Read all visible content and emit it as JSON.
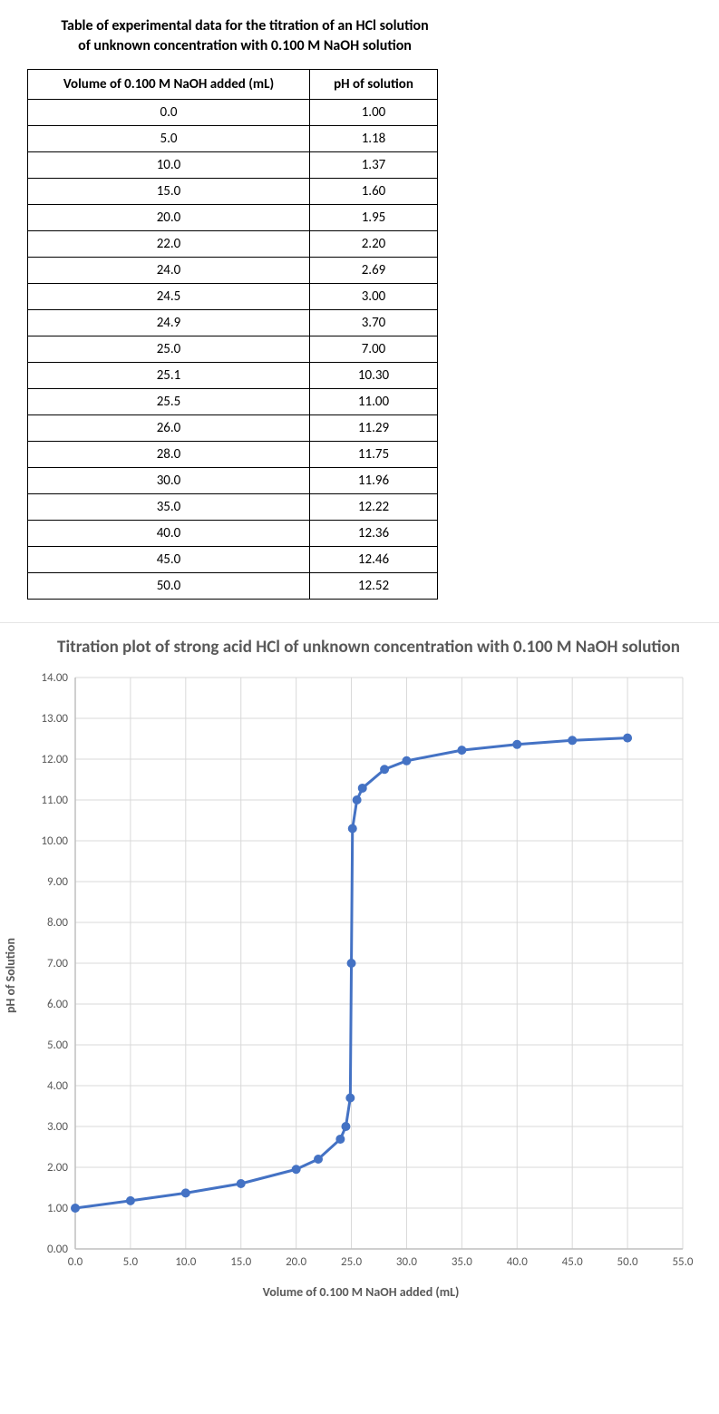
{
  "table": {
    "title": "Table of experimental data for the titration of an HCl solution of unknown concentration with 0.100 M NaOH solution",
    "headers": [
      "Volume of 0.100 M NaOH added (mL)",
      "pH of solution"
    ],
    "rows": [
      {
        "vol": "0.0",
        "ph": "1.00"
      },
      {
        "vol": "5.0",
        "ph": "1.18"
      },
      {
        "vol": "10.0",
        "ph": "1.37"
      },
      {
        "vol": "15.0",
        "ph": "1.60"
      },
      {
        "vol": "20.0",
        "ph": "1.95"
      },
      {
        "vol": "22.0",
        "ph": "2.20"
      },
      {
        "vol": "24.0",
        "ph": "2.69"
      },
      {
        "vol": "24.5",
        "ph": "3.00"
      },
      {
        "vol": "24.9",
        "ph": "3.70"
      },
      {
        "vol": "25.0",
        "ph": "7.00"
      },
      {
        "vol": "25.1",
        "ph": "10.30"
      },
      {
        "vol": "25.5",
        "ph": "11.00"
      },
      {
        "vol": "26.0",
        "ph": "11.29"
      },
      {
        "vol": "28.0",
        "ph": "11.75"
      },
      {
        "vol": "30.0",
        "ph": "11.96"
      },
      {
        "vol": "35.0",
        "ph": "12.22"
      },
      {
        "vol": "40.0",
        "ph": "12.36"
      },
      {
        "vol": "45.0",
        "ph": "12.46"
      },
      {
        "vol": "50.0",
        "ph": "12.52"
      }
    ]
  },
  "chart_data": {
    "type": "line",
    "title": "Titration plot of strong acid HCl of unknown concentration with 0.100 M NaOH solution",
    "xlabel": "Volume of 0.100 M NaOH added (mL)",
    "ylabel": "pH of Solution",
    "xlim": [
      0,
      55
    ],
    "ylim": [
      0,
      14
    ],
    "x_ticks": [
      "0.0",
      "5.0",
      "10.0",
      "15.0",
      "20.0",
      "25.0",
      "30.0",
      "35.0",
      "40.0",
      "45.0",
      "50.0",
      "55.0"
    ],
    "y_ticks": [
      "0.00",
      "1.00",
      "2.00",
      "3.00",
      "4.00",
      "5.00",
      "6.00",
      "7.00",
      "8.00",
      "9.00",
      "10.00",
      "11.00",
      "12.00",
      "13.00",
      "14.00"
    ],
    "marker_color": "#4472C4",
    "line_color": "#4472C4",
    "grid": true,
    "series": [
      {
        "name": "pH",
        "x": [
          0.0,
          5.0,
          10.0,
          15.0,
          20.0,
          22.0,
          24.0,
          24.5,
          24.9,
          25.0,
          25.1,
          25.5,
          26.0,
          28.0,
          30.0,
          35.0,
          40.0,
          45.0,
          50.0
        ],
        "y": [
          1.0,
          1.18,
          1.37,
          1.6,
          1.95,
          2.2,
          2.69,
          3.0,
          3.7,
          7.0,
          10.3,
          11.0,
          11.29,
          11.75,
          11.96,
          12.22,
          12.36,
          12.46,
          12.52
        ]
      }
    ]
  }
}
